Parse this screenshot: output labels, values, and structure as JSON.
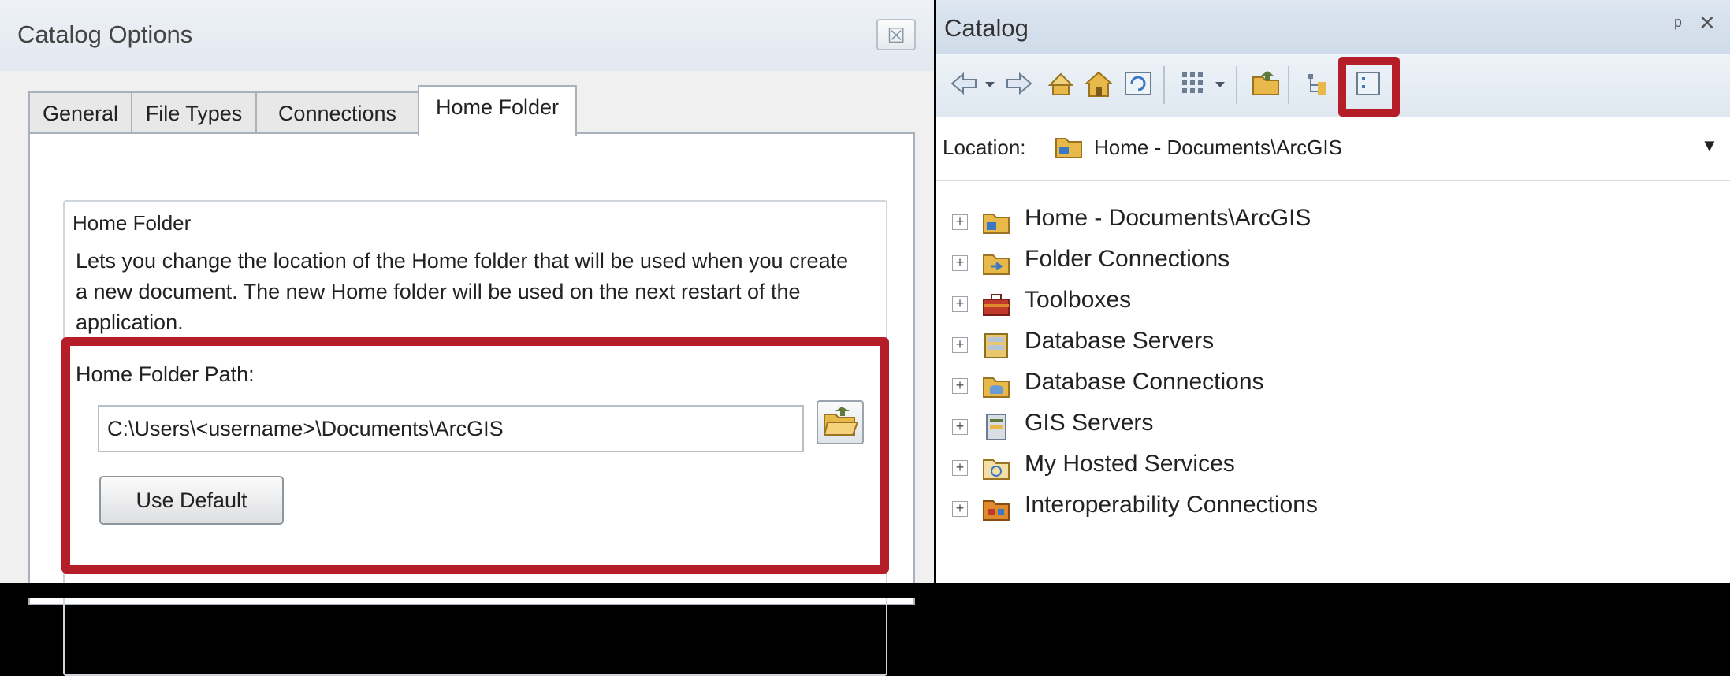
{
  "dialog": {
    "title": "Catalog Options",
    "close_glyph": "☒",
    "tabs": [
      {
        "label": "General"
      },
      {
        "label": "File Types"
      },
      {
        "label": "Connections"
      },
      {
        "label": "Home Folder",
        "active": true
      }
    ],
    "group_legend": "Home Folder",
    "description": "Lets you change the location of the Home folder that will be used when you create a new document.  The new Home folder will be used on the next restart of the application.",
    "path_label": "Home Folder Path:",
    "path_value": "C:\\Users\\<username>\\Documents\\ArcGIS",
    "use_default_label": "Use Default"
  },
  "catalog": {
    "title": "Catalog",
    "pin_glyph": "ᵖ",
    "close_glyph": "×",
    "location_label": "Location:",
    "location_value": "Home - Documents\\ArcGIS",
    "tree": [
      {
        "label": "Home - Documents\\ArcGIS",
        "icon": "home-folder-icon"
      },
      {
        "label": "Folder Connections",
        "icon": "folder-connections-icon"
      },
      {
        "label": "Toolboxes",
        "icon": "toolboxes-icon"
      },
      {
        "label": "Database Servers",
        "icon": "database-servers-icon"
      },
      {
        "label": "Database Connections",
        "icon": "database-connections-icon"
      },
      {
        "label": "GIS Servers",
        "icon": "gis-servers-icon"
      },
      {
        "label": "My Hosted Services",
        "icon": "hosted-services-icon"
      },
      {
        "label": "Interoperability Connections",
        "icon": "interoperability-icon"
      }
    ]
  },
  "colors": {
    "highlight": "#b51e29",
    "folder": "#e8b94a"
  }
}
